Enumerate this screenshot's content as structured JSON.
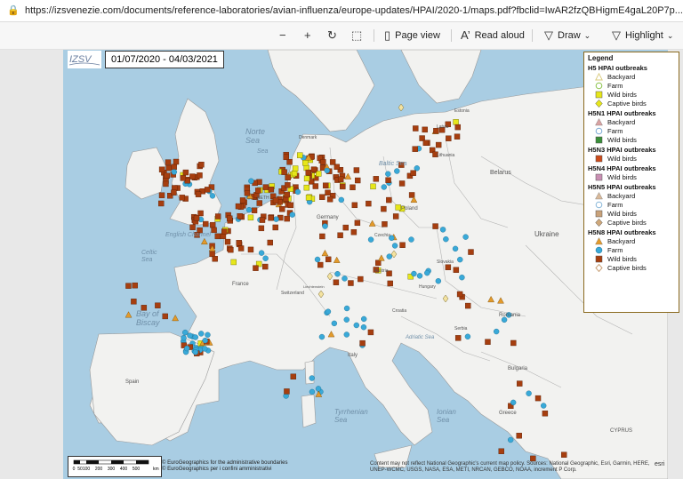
{
  "browser": {
    "url": "https://izsvenezie.com/documents/reference-laboratories/avian-influenza/europe-updates/HPAI/2020-1/maps.pdf?fbclid=IwAR2fzQBHigmE4gaL20P7p..."
  },
  "toolbar": {
    "zoom_out_icon": "minus-icon",
    "zoom_in_icon": "plus-icon",
    "rotate_icon": "rotate-icon",
    "fit_icon": "fit-page-icon",
    "page_view_label": "Page view",
    "read_aloud_label": "Read aloud",
    "draw_label": "Draw",
    "highlight_label": "Highlight"
  },
  "map": {
    "date_range": "01/07/2020 - 04/03/2021",
    "colors": {
      "sea": "#a9cde3",
      "land": "#f2f2f0",
      "border": "#9a9a9a",
      "wild_birds": "#a63e0f",
      "farm": "#39a9d8",
      "backyard_h5n8": "#e39a2b",
      "h5_wild": "#e6e61a",
      "h5n1_wild": "#7a6f6f",
      "h5n3_wild": "#cc4b1b",
      "h5n4_wild": "#c98fb3",
      "h5n5_wild": "#c9a27a"
    },
    "places": {
      "norte_sea": "Norte\nSea",
      "baltic_sea": "Baltic Sea",
      "north_sea2": "Sea",
      "english_channel": "English Channel",
      "bay_of_biscay": "Bay of\nBiscay",
      "celtic_sea": "Celtic\nSea",
      "germany": "Germany",
      "poland": "Poland",
      "france": "France",
      "spain": "Spain",
      "italy": "Italy",
      "ukraine": "Ukraine",
      "belarus": "Belarus",
      "romania": "Romania",
      "hungary": "Hungary",
      "austria": "Austria",
      "czechia": "Czechia",
      "slovakia": "Slovakia",
      "croatia": "Croatia",
      "serbia": "Serbia",
      "bulgaria": "Bulgaria",
      "lithuania": "Lithuania",
      "latvia": "Latvia",
      "estonia": "Estonia",
      "switzerland": "Switzerland",
      "liechtenstein": "Liechtenstein",
      "netherlands": "NETH",
      "denmark": "Denmark",
      "tyrrhenian_sea": "Tyrrhenian\nSea",
      "adriatic_sea": "Adriatic Sea",
      "ionian_sea": "Ionian\nSea",
      "greece": "Greece",
      "cyprus": "CYPRUS"
    }
  },
  "legend": {
    "title": "Legend",
    "groups": [
      {
        "title": "H5 HPAI outbreaks",
        "items": [
          {
            "label": "Backyard",
            "shape": "triangle-outline",
            "color": "#d9c97a"
          },
          {
            "label": "Farm",
            "shape": "circle-outline",
            "color": "#8bc34a"
          },
          {
            "label": "Wild birds",
            "shape": "square",
            "color": "#e6e61a"
          },
          {
            "label": "Captive birds",
            "shape": "diamond",
            "color": "#e6e61a"
          }
        ]
      },
      {
        "title": "H5N1 HPAI outbreaks",
        "items": [
          {
            "label": "Backyard",
            "shape": "triangle",
            "color": "#d9a2a2"
          },
          {
            "label": "Farm",
            "shape": "circle-outline",
            "color": "#7aa9d4"
          },
          {
            "label": "Wild birds",
            "shape": "square",
            "color": "#3a8f3a"
          }
        ]
      },
      {
        "title": "H5N3 HPAI outbreaks",
        "items": [
          {
            "label": "Wild birds",
            "shape": "square",
            "color": "#cc4b1b"
          }
        ]
      },
      {
        "title": "H5N4 HPAI outbreaks",
        "items": [
          {
            "label": "Wild birds",
            "shape": "square",
            "color": "#c98fb3"
          }
        ]
      },
      {
        "title": "H5N5 HPAI outbreaks",
        "items": [
          {
            "label": "Backyard",
            "shape": "triangle",
            "color": "#d9b99a"
          },
          {
            "label": "Farm",
            "shape": "circle-outline",
            "color": "#88b6d9"
          },
          {
            "label": "Wild birds",
            "shape": "square",
            "color": "#c9a27a"
          },
          {
            "label": "Captive birds",
            "shape": "diamond",
            "color": "#cfa87a"
          }
        ]
      },
      {
        "title": "H5N8 HPAI outbreaks",
        "items": [
          {
            "label": "Backyard",
            "shape": "triangle",
            "color": "#e39a2b"
          },
          {
            "label": "Farm",
            "shape": "circle",
            "color": "#39a9d8"
          },
          {
            "label": "Wild birds",
            "shape": "square",
            "color": "#a63e0f"
          },
          {
            "label": "Captive birds",
            "shape": "diamond-outline",
            "color": "#c9a27a"
          }
        ]
      }
    ]
  },
  "scale": {
    "ticks": [
      "0",
      "50",
      "100",
      "200",
      "300",
      "400",
      "500"
    ],
    "unit": "km"
  },
  "credits": {
    "line1": "© EuroGeographics for the administrative boundaries",
    "line2": "© EuroGeographics per i confini amministrativi"
  },
  "attribution": {
    "text": "Content may not reflect National Geographic's current map policy. Sources: National Geographic, Esri, Garmin, HERE, UNEP-WCMC, USGS, NASA, ESA, METI, NRCAN, GEBCO, NOAA, increment P Corp.",
    "esri": "esri"
  }
}
